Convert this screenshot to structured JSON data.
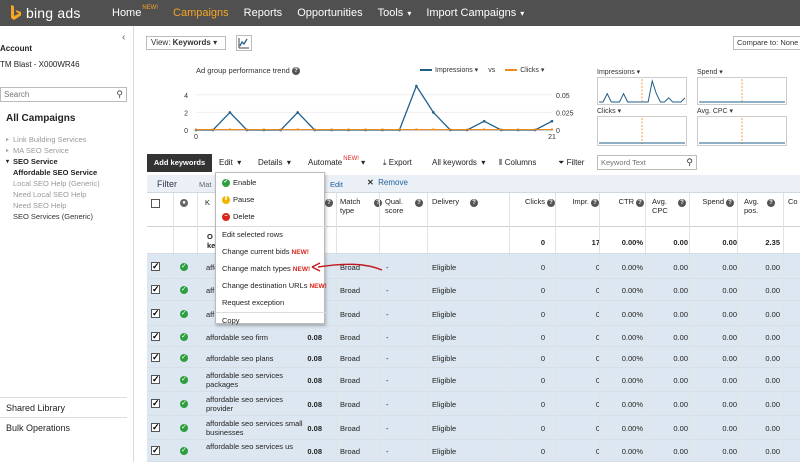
{
  "topbar": {
    "logo": "bing ads",
    "nav": [
      {
        "label": "Home",
        "badge": "NEW!"
      },
      {
        "label": "Campaigns"
      },
      {
        "label": "Reports"
      },
      {
        "label": "Opportunities"
      },
      {
        "label": "Tools"
      },
      {
        "label": "Import Campaigns"
      }
    ]
  },
  "sidebar": {
    "account_label": "Account",
    "account_value": "TM Blast - X000WR46",
    "search_placeholder": "Search",
    "all_campaigns": "All Campaigns",
    "tree": [
      {
        "label": "Link Building Services",
        "style": "gray",
        "tri": "▸"
      },
      {
        "label": "MA SEO Service",
        "style": "gray",
        "tri": "▸"
      },
      {
        "label": "SEO Service",
        "style": "bold",
        "tri": "▾"
      },
      {
        "label": "Affordable SEO Service",
        "style": "bold",
        "tri": ""
      },
      {
        "label": "Local SEO Help (Generic)",
        "style": "gray",
        "tri": ""
      },
      {
        "label": "Need Local SEO Help",
        "style": "gray",
        "tri": ""
      },
      {
        "label": "Need SEO Help",
        "style": "gray",
        "tri": ""
      },
      {
        "label": "SEO Services (Generic)",
        "style": "dark",
        "tri": ""
      }
    ],
    "shared_library": "Shared Library",
    "bulk_operations": "Bulk Operations"
  },
  "view": {
    "prefix": "View: ",
    "value": "Keywords"
  },
  "compare_label": "Compare to: None",
  "chart": {
    "title": "Ad group performance trend",
    "legend": [
      {
        "name": "Impressions",
        "color": "#1f5f8b"
      },
      {
        "name": "Clicks",
        "color": "#f08a1d"
      }
    ],
    "vs": "vs",
    "left_ticks": [
      "4",
      "2",
      "0"
    ],
    "right_ticks": [
      "0.05",
      "0.025",
      "0"
    ],
    "x_ticks": [
      "0",
      "21"
    ],
    "impressions": [
      0,
      0,
      2,
      0,
      0,
      0,
      2,
      0,
      0,
      0,
      0,
      0,
      0,
      5,
      2,
      0,
      0,
      1,
      0,
      0,
      0,
      1
    ],
    "clicks": [
      0,
      0,
      0,
      0,
      0,
      0,
      0,
      0,
      0,
      0,
      0,
      0,
      0,
      0,
      0,
      0,
      0,
      0,
      0,
      0,
      0,
      0
    ],
    "minis": [
      {
        "label": "Impressions"
      },
      {
        "label": "Spend"
      },
      {
        "label": "Clicks"
      },
      {
        "label": "Avg. CPC"
      }
    ]
  },
  "toolbar": {
    "add_keywords": "Add keywords",
    "edit": "Edit",
    "details": "Details",
    "automate": "Automate",
    "automate_badge": "NEW!",
    "export": "Export",
    "all_keywords": "All keywords",
    "columns": "Columns",
    "filter": "Filter",
    "keyword_text_placeholder": "Keyword Text"
  },
  "filterbar": {
    "filter": "Filter",
    "mat": "Mat",
    "edit": "Edit",
    "remove": "Remove"
  },
  "columns": {
    "keyword": "K",
    "match_type": "Match type",
    "qual_score": "Qual. score",
    "delivery": "Delivery",
    "clicks": "Clicks",
    "impr": "Impr.",
    "ctr": "CTR",
    "avg_cpc": "Avg. CPC",
    "spend": "Spend",
    "avg_pos": "Avg. pos.",
    "cut": "Co"
  },
  "total_row": {
    "label": "O ke",
    "clicks": "0",
    "impr": "17",
    "ctr": "0.00%",
    "avg_cpc": "0.00",
    "spend": "0.00",
    "avg_pos": "2.35"
  },
  "rows": [
    {
      "keyword": "affordable se",
      "bid": "",
      "match": "Broad",
      "qual": "-",
      "delivery": "Eligible",
      "clicks": "0",
      "impr": "0",
      "ctr": "0.00%",
      "cpc": "0.00",
      "spend": "0.00",
      "pos": "0.00"
    },
    {
      "keyword": "aff",
      "bid": "",
      "match": "Broad",
      "qual": "-",
      "delivery": "Eligible",
      "clicks": "0",
      "impr": "0",
      "ctr": "0.00%",
      "cpc": "0.00",
      "spend": "0.00",
      "pos": "0.00"
    },
    {
      "keyword": "aff ur",
      "bid": "",
      "match": "Broad",
      "qual": "-",
      "delivery": "Eligible",
      "clicks": "0",
      "impr": "0",
      "ctr": "0.00%",
      "cpc": "0.00",
      "spend": "0.00",
      "pos": "0.00"
    },
    {
      "keyword": "affordable seo firm",
      "bid": "0.08",
      "match": "Broad",
      "qual": "-",
      "delivery": "Eligible",
      "clicks": "0",
      "impr": "0",
      "ctr": "0.00%",
      "cpc": "0.00",
      "spend": "0.00",
      "pos": "0.00"
    },
    {
      "keyword": "affordable seo plans",
      "bid": "0.08",
      "match": "Broad",
      "qual": "-",
      "delivery": "Eligible",
      "clicks": "0",
      "impr": "0",
      "ctr": "0.00%",
      "cpc": "0.00",
      "spend": "0.00",
      "pos": "0.00"
    },
    {
      "keyword": "affordable seo services packages",
      "bid": "0.08",
      "match": "Broad",
      "qual": "-",
      "delivery": "Eligible",
      "clicks": "0",
      "impr": "0",
      "ctr": "0.00%",
      "cpc": "0.00",
      "spend": "0.00",
      "pos": "0.00"
    },
    {
      "keyword": "affordable seo services provider",
      "bid": "0.08",
      "match": "Broad",
      "qual": "-",
      "delivery": "Eligible",
      "clicks": "0",
      "impr": "0",
      "ctr": "0.00%",
      "cpc": "0.00",
      "spend": "0.00",
      "pos": "0.00"
    },
    {
      "keyword": "affordable seo services small businesses",
      "bid": "0.08",
      "match": "Broad",
      "qual": "-",
      "delivery": "Eligible",
      "clicks": "0",
      "impr": "0",
      "ctr": "0.00%",
      "cpc": "0.00",
      "spend": "0.00",
      "pos": "0.00"
    },
    {
      "keyword": "affordable seo services us",
      "bid": "0.08",
      "match": "Broad",
      "qual": "-",
      "delivery": "Eligible",
      "clicks": "0",
      "impr": "0",
      "ctr": "0.00%",
      "cpc": "0.00",
      "spend": "0.00",
      "pos": "0.00"
    }
  ],
  "edit_menu": [
    {
      "label": "Enable",
      "icon": "enable",
      "badge": ""
    },
    {
      "label": "Pause",
      "icon": "pause",
      "badge": ""
    },
    {
      "label": "Delete",
      "icon": "delete",
      "badge": ""
    },
    {
      "label": "Edit selected rows",
      "icon": "",
      "badge": ""
    },
    {
      "label": "Change current bids",
      "icon": "",
      "badge": "NEW!"
    },
    {
      "label": "Change match types",
      "icon": "",
      "badge": "NEW!"
    },
    {
      "label": "Change destination URLs",
      "icon": "",
      "badge": "NEW!"
    },
    {
      "label": "Request exception",
      "icon": "",
      "badge": ""
    },
    {
      "label": "Copy",
      "icon": "",
      "badge": ""
    }
  ],
  "colors": {
    "topbar": "#505050",
    "nav_active": "#f6a623",
    "selected_row": "#dde7f1",
    "badge_red": "#d9251c",
    "annotation_arrow": "#c0181e"
  }
}
